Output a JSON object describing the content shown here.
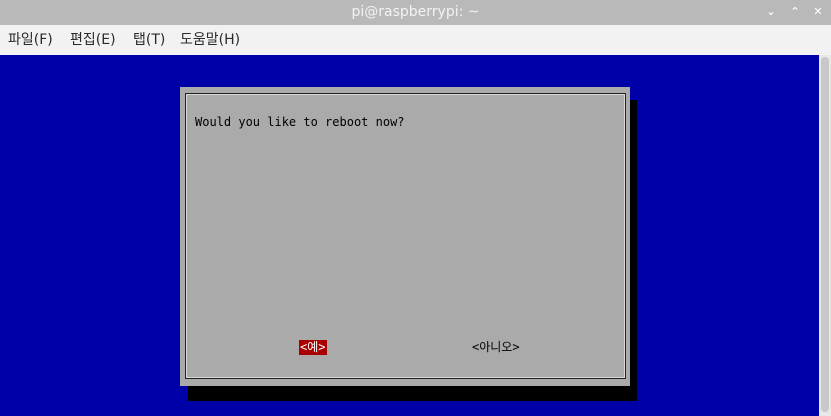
{
  "window": {
    "title": "pi@raspberrypi: ~",
    "controls": {
      "minimize": "⌄",
      "maximize": "⌃",
      "close": "✕"
    }
  },
  "menu": [
    "파일(F)",
    "편집(E)",
    "탭(T)",
    "도움말(H)"
  ],
  "dialog": {
    "question": "Would you like to reboot now?",
    "yes_label": "<예>",
    "no_label": "<아니오>"
  },
  "colors": {
    "terminal_bg": "#0000a8",
    "dialog_bg": "#aaaaaa",
    "selected_button_bg": "#a80000"
  }
}
